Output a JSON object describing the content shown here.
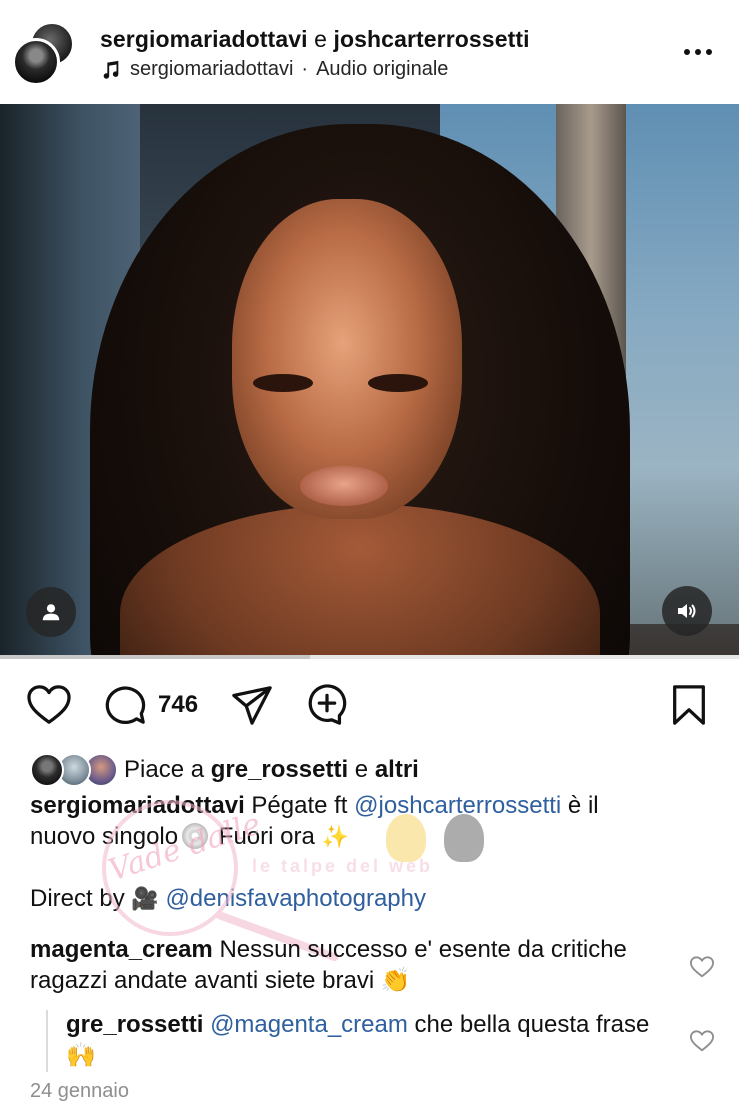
{
  "header": {
    "user1": "sergiomariadottavi",
    "conjunction": "e",
    "user2": "joshcarterrossetti",
    "audio_user": "sergiomariadottavi",
    "audio_sep": "·",
    "audio_label": "Audio originale",
    "icons": {
      "music": "music-note-icon",
      "more": "more-horizontal-icon"
    }
  },
  "media": {
    "type": "video",
    "progress_fraction": 0.42,
    "icons": {
      "tag": "user-tag-icon",
      "sound": "speaker-icon"
    }
  },
  "actions": {
    "comment_count": "746",
    "icons": [
      "heart-icon",
      "comment-icon",
      "share-icon",
      "remix-icon",
      "bookmark-icon"
    ]
  },
  "likes": {
    "prefix": "Piace a",
    "user": "gre_rossetti",
    "conj": "e",
    "others": "altri"
  },
  "caption": {
    "user": "sergiomariadottavi",
    "text1": "Pégate ft",
    "mention1": "@joshcarterrossetti",
    "text2": "è il",
    "text3": "nuovo singolo",
    "text4": "Fuori ora",
    "direct_label": "Direct by",
    "mention2": "@denisfavaphotography"
  },
  "comments": [
    {
      "user": "magenta_cream",
      "text": "Nessun successo e' esente da critiche ragazzi andate avanti siete bravi"
    }
  ],
  "reply": {
    "user": "gre_rossetti",
    "mention": "@magenta_cream",
    "text": "che bella questa frase"
  },
  "date": "24 gennaio",
  "watermark": {
    "text1": "Vade dalle",
    "text2": "le talpe del web"
  },
  "colors": {
    "mention": "#2f5f9e",
    "muted": "#8e8e8e",
    "text": "#111111"
  }
}
